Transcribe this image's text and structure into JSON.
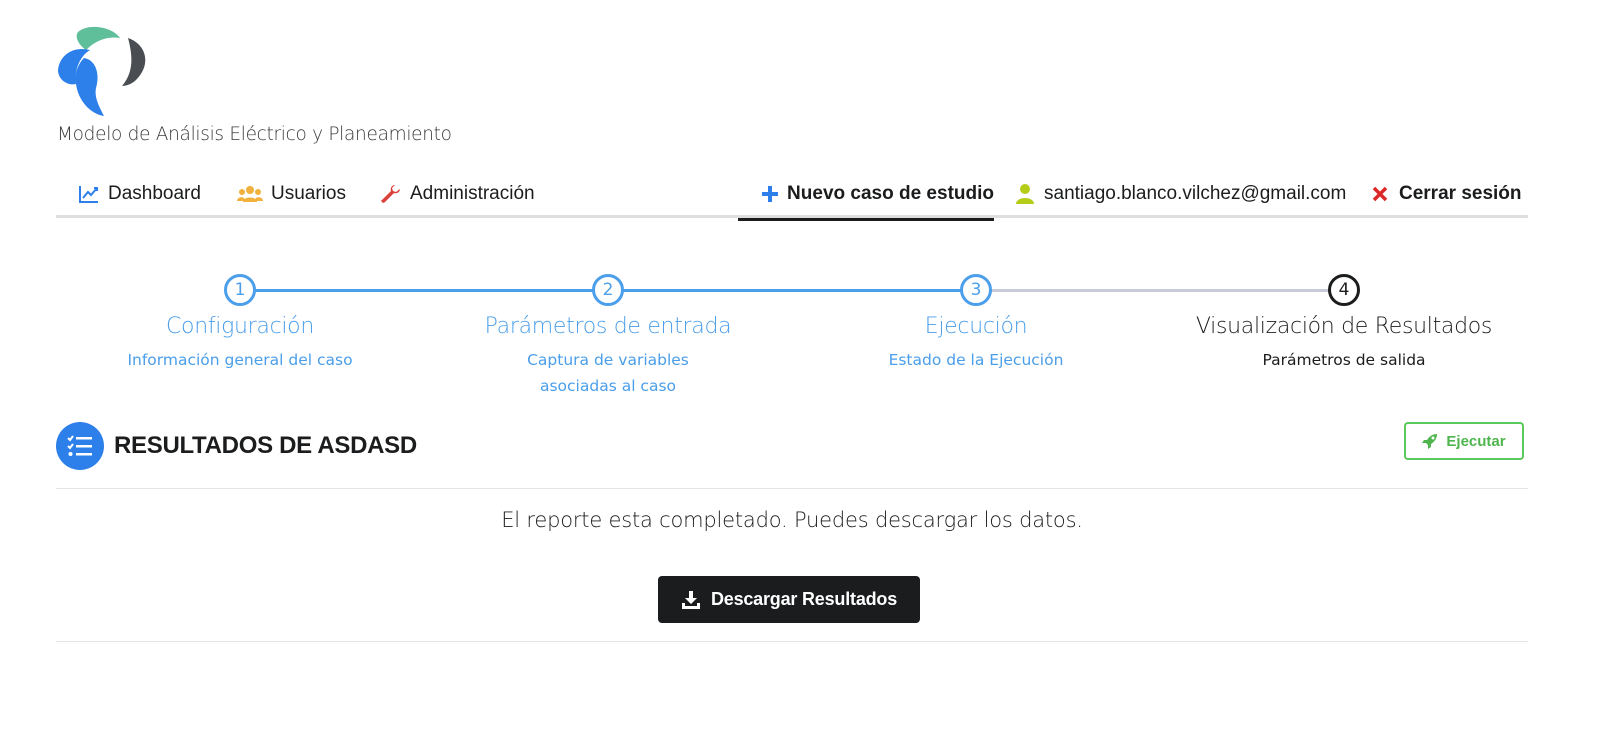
{
  "app": {
    "title": "Modelo de Análisis Eléctrico y Planeamiento"
  },
  "menu": {
    "items": [
      {
        "label": "Dashboard",
        "icon": "chart-line-icon",
        "color": "#2d7fe9"
      },
      {
        "label": "Usuarios",
        "icon": "users-icon",
        "color": "#f2b13c"
      },
      {
        "label": "Administración",
        "icon": "wrench-icon",
        "color": "#d9413a"
      }
    ],
    "new_case": {
      "label": "Nuevo caso de estudio",
      "icon": "plus-icon",
      "color": "#2d7fe9",
      "active": true
    },
    "user": {
      "label": "santiago.blanco.vilchez@gmail.com",
      "icon": "user-icon",
      "color": "#b5cc18"
    },
    "logout": {
      "label": "Cerrar sesión",
      "icon": "close-icon",
      "color": "#db2828"
    }
  },
  "steps": [
    {
      "number": "1",
      "title": "Configuración",
      "subtitle": "Información general del caso",
      "subtitle2": "",
      "state": "completed"
    },
    {
      "number": "2",
      "title": "Parámetros de entrada",
      "subtitle": "Captura de variables",
      "subtitle2": "asociadas al caso",
      "state": "completed"
    },
    {
      "number": "3",
      "title": "Ejecución",
      "subtitle": "Estado de la Ejecución",
      "subtitle2": "",
      "state": "completed"
    },
    {
      "number": "4",
      "title": "Visualización de Resultados",
      "subtitle": "Parámetros de salida",
      "subtitle2": "",
      "state": "current"
    }
  ],
  "results": {
    "title": "RESULTADOS DE ASDASD",
    "icon": "list-check-icon",
    "run_button": "Ejecutar",
    "message": "El reporte esta completado. Puedes descargar los datos.",
    "download_button": "Descargar Resultados"
  },
  "colors": {
    "accent": "#4a9eea",
    "primary": "#2d7fe9",
    "success": "#5bc85b",
    "dark": "#1b1c1d",
    "pending_line": "#c9cbd6"
  }
}
